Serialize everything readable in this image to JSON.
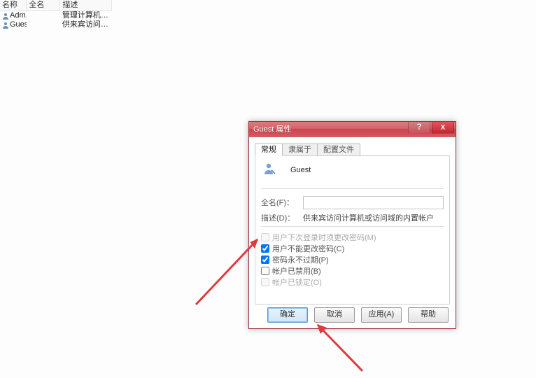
{
  "grid": {
    "headers": {
      "name": "名称",
      "fullname": "全名",
      "desc": "描述"
    },
    "rows": [
      {
        "name": "Adm...",
        "fullname": "",
        "desc": "管理计算机(域)..."
      },
      {
        "name": "Guest",
        "fullname": "",
        "desc": "供来宾访问计算..."
      }
    ]
  },
  "dialog": {
    "title": "Guest 属性",
    "tabs": {
      "general": "常规",
      "memberof": "隶属于",
      "profile": "配置文件"
    },
    "username": "Guest",
    "fields": {
      "fullname_label": "全名(F)：",
      "fullname_value": "",
      "desc_label": "描述(D)：",
      "desc_value": "供来宾访问计算机或访问域的内置帐户"
    },
    "checks": {
      "c1": "用户下次登录时须更改密码(M)",
      "c2": "用户不能更改密码(C)",
      "c3": "密码永不过期(P)",
      "c4": "帐户已禁用(B)",
      "c5": "帐户已锁定(O)"
    },
    "buttons": {
      "ok": "确定",
      "cancel": "取消",
      "apply": "应用(A)",
      "help": "帮助"
    }
  }
}
